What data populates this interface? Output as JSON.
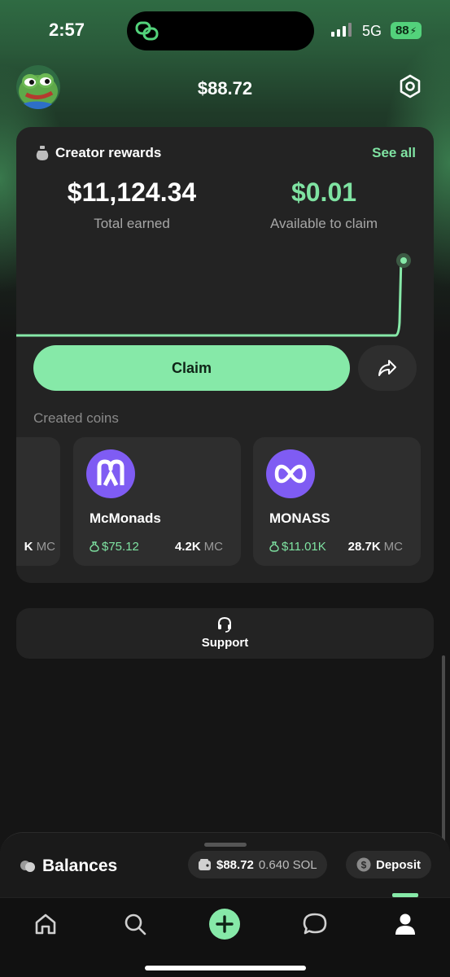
{
  "status": {
    "time": "2:57",
    "network": "5G",
    "battery": "88"
  },
  "header": {
    "balance": "$88.72",
    "avatar_icon": "frog-avatar-icon",
    "settings_icon": "gear-icon"
  },
  "rewards": {
    "title": "Creator rewards",
    "see_all": "See all",
    "total_value": "$11,124.34",
    "total_label": "Total earned",
    "available_value": "$0.01",
    "available_label": "Available to claim",
    "claim_label": "Claim",
    "accent": "#7fe3a2"
  },
  "created_coins": {
    "label": "Created coins",
    "partial_mc_unit": "MC",
    "coins": [
      {
        "name": "McMonads",
        "earned": "$75.12",
        "mc": "4.2K",
        "mc_unit": "MC",
        "logo_color": "#7f5cf3"
      },
      {
        "name": "MONASS",
        "earned": "$11.01K",
        "mc": "28.7K",
        "mc_unit": "MC",
        "logo_color": "#7f5cf3"
      }
    ]
  },
  "support": {
    "label": "Support"
  },
  "balances": {
    "title": "Balances",
    "usd": "$88.72",
    "sol": "0.640 SOL",
    "deposit": "Deposit"
  },
  "tabs": [
    "home-icon",
    "search-icon",
    "create-icon",
    "chat-icon",
    "profile-icon"
  ]
}
